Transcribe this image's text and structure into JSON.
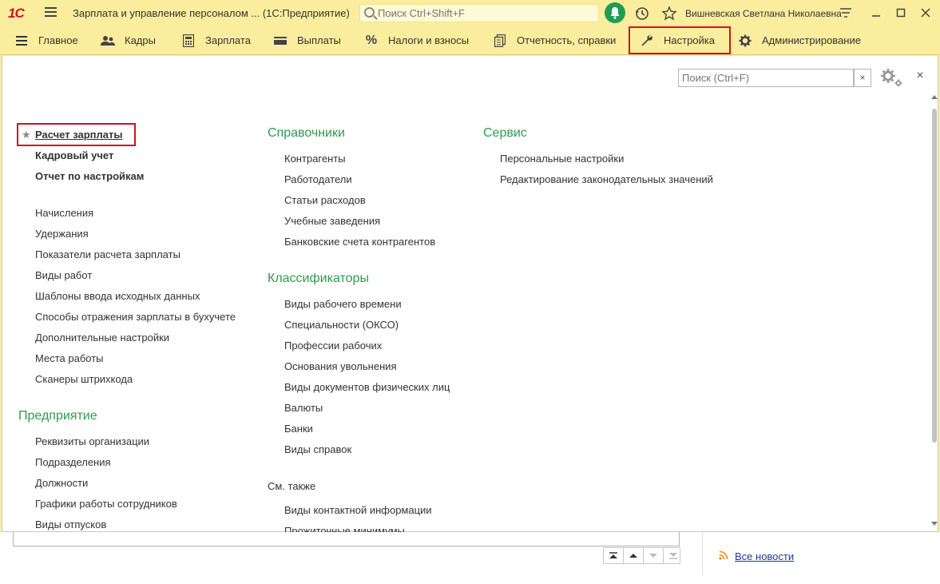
{
  "titlebar": {
    "logo": "1С",
    "app_title": "Зарплата и управление персоналом ...  (1С:Предприятие)",
    "search_placeholder": "Поиск Ctrl+Shift+F",
    "user": "Вишневская Светлана Николаевна"
  },
  "sections": [
    {
      "label": "Главное",
      "icon": "hamburger-icon"
    },
    {
      "label": "Кадры",
      "icon": "people-icon"
    },
    {
      "label": "Зарплата",
      "icon": "calculator-icon"
    },
    {
      "label": "Выплаты",
      "icon": "wallet-icon"
    },
    {
      "label": "Налоги и взносы",
      "icon": "percent-icon"
    },
    {
      "label": "Отчетность, справки",
      "icon": "documents-icon"
    },
    {
      "label": "Настройка",
      "icon": "wrench-icon",
      "active": true
    },
    {
      "label": "Администрирование",
      "icon": "gear-icon"
    }
  ],
  "panel": {
    "search_placeholder": "Поиск (Ctrl+F)",
    "clear": "×",
    "close": "×"
  },
  "col1": {
    "favorite": "Расчет зарплаты",
    "bold_links": [
      "Кадровый учет",
      "Отчет по настройкам"
    ],
    "links": [
      "Начисления",
      "Удержания",
      "Показатели расчета зарплаты",
      "Виды работ",
      "Шаблоны ввода исходных данных",
      "Способы отражения зарплаты в бухучете",
      "Дополнительные настройки",
      "Места работы",
      "Сканеры штрихкода"
    ],
    "group2_title": "Предприятие",
    "group2_links": [
      "Реквизиты организации",
      "Подразделения",
      "Должности",
      "Графики работы сотрудников",
      "Виды отпусков"
    ]
  },
  "col2": {
    "group1_title": "Справочники",
    "group1_links": [
      "Контрагенты",
      "Работодатели",
      "Статьи расходов",
      "Учебные заведения",
      "Банковские счета контрагентов"
    ],
    "group2_title": "Классификаторы",
    "group2_links": [
      "Виды рабочего времени",
      "Специальности (ОКСО)",
      "Профессии рабочих",
      "Основания увольнения",
      "Виды документов физических лиц",
      "Валюты",
      "Банки",
      "Виды справок"
    ],
    "see_also": "См. также",
    "see_also_links": [
      "Виды контактной информации",
      "Прожиточные минимумы"
    ]
  },
  "col3": {
    "group_title": "Сервис",
    "links": [
      "Персональные настройки",
      "Редактирование законодательных значений"
    ]
  },
  "bottom": {
    "all_news": "Все новости"
  },
  "colors": {
    "accent_yellow": "#fbed9e",
    "group_green": "#2e9a4e",
    "highlight_red": "#d0121b",
    "link_blue": "#1f3a8f"
  }
}
